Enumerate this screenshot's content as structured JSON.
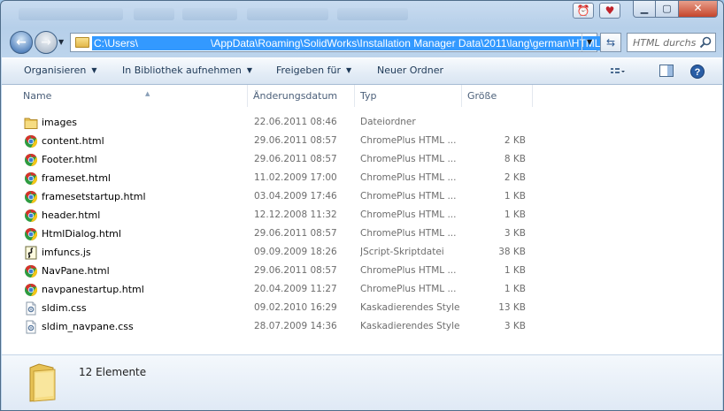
{
  "window": {
    "address_path_prefix": "C:\\Users\\",
    "address_path_suffix": "\\AppData\\Roaming\\SolidWorks\\Installation Manager Data\\2011\\lang\\german\\HTML",
    "search_placeholder": "HTML durchsuchen"
  },
  "toolbar": {
    "organize": "Organisieren",
    "include_library": "In Bibliothek aufnehmen",
    "share": "Freigeben für",
    "new_folder": "Neuer Ordner"
  },
  "columns": {
    "name": "Name",
    "modified": "Änderungsdatum",
    "type": "Typ",
    "size": "Größe"
  },
  "files": [
    {
      "icon": "folder",
      "name": "images",
      "date": "22.06.2011 08:46",
      "type": "Dateiordner",
      "size": ""
    },
    {
      "icon": "chrome",
      "name": "content.html",
      "date": "29.06.2011 08:57",
      "type": "ChromePlus HTML ...",
      "size": "2 KB"
    },
    {
      "icon": "chrome",
      "name": "Footer.html",
      "date": "29.06.2011 08:57",
      "type": "ChromePlus HTML ...",
      "size": "8 KB"
    },
    {
      "icon": "chrome",
      "name": "frameset.html",
      "date": "11.02.2009 17:00",
      "type": "ChromePlus HTML ...",
      "size": "2 KB"
    },
    {
      "icon": "chrome",
      "name": "framesetstartup.html",
      "date": "03.04.2009 17:46",
      "type": "ChromePlus HTML ...",
      "size": "1 KB"
    },
    {
      "icon": "chrome",
      "name": "header.html",
      "date": "12.12.2008 11:32",
      "type": "ChromePlus HTML ...",
      "size": "1 KB"
    },
    {
      "icon": "chrome",
      "name": "HtmlDialog.html",
      "date": "29.06.2011 08:57",
      "type": "ChromePlus HTML ...",
      "size": "3 KB"
    },
    {
      "icon": "script",
      "name": "imfuncs.js",
      "date": "09.09.2009 18:26",
      "type": "JScript-Skriptdatei",
      "size": "38 KB"
    },
    {
      "icon": "chrome",
      "name": "NavPane.html",
      "date": "29.06.2011 08:57",
      "type": "ChromePlus HTML ...",
      "size": "1 KB"
    },
    {
      "icon": "chrome",
      "name": "navpanestartup.html",
      "date": "20.04.2009 11:27",
      "type": "ChromePlus HTML ...",
      "size": "1 KB"
    },
    {
      "icon": "css",
      "name": "sldim.css",
      "date": "09.02.2010 16:29",
      "type": "Kaskadierendes Stylesheet",
      "size": "13 KB"
    },
    {
      "icon": "css",
      "name": "sldim_navpane.css",
      "date": "28.07.2009 14:36",
      "type": "Kaskadierendes Stylesheet",
      "size": "3 KB"
    }
  ],
  "status": {
    "item_count": "12 Elemente"
  }
}
